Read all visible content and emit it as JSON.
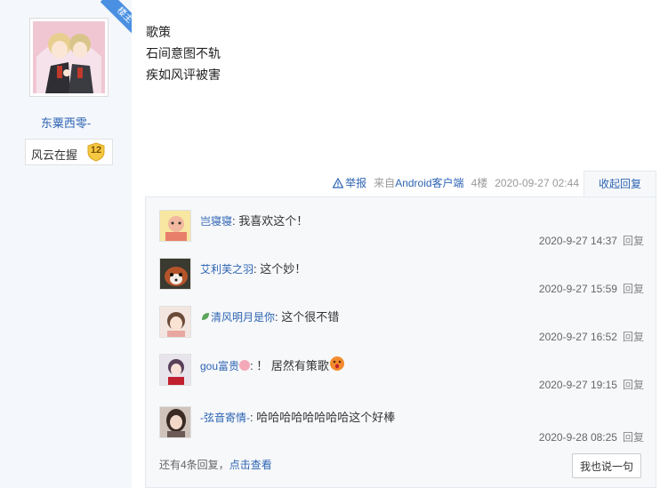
{
  "author": {
    "badge": "楼主",
    "name": "东粟西零-",
    "rank_name": "风云在握",
    "rank_level": "12"
  },
  "post": {
    "lines": [
      "歌策",
      "石间意图不轨",
      "疾如风评被害"
    ],
    "report_label": "举报",
    "source_prefix": "来自",
    "source_link": "Android客户端",
    "floor": "4楼",
    "timestamp": "2020-09-27 02:44",
    "collapse_label": "收起回复"
  },
  "replies": [
    {
      "name": "岂寝寝",
      "text": "我喜欢这个！",
      "time": "2020-9-27 14:37",
      "reply_label": "回复"
    },
    {
      "name": "艾利芙之羽",
      "text": "这个妙！",
      "time": "2020-9-27 15:59",
      "reply_label": "回复"
    },
    {
      "name": "清风明月是你",
      "text": "这个很不错",
      "time": "2020-9-27 16:52",
      "reply_label": "回复"
    },
    {
      "name": "gou富贵",
      "text": "！ 居然有策歌",
      "time": "2020-9-27 19:15",
      "reply_label": "回复"
    },
    {
      "name": "-弦音寄情-",
      "text": "哈哈哈哈哈哈哈哈这个好棒",
      "time": "2020-9-28 08:25",
      "reply_label": "回复"
    }
  ],
  "more": {
    "text": "还有4条回复，",
    "link": "点击查看"
  },
  "say_button": "我也说一句",
  "colors": {
    "link": "#2d64b3",
    "badge": "#4a90e2",
    "sidebar_bg": "#f4f7fb"
  }
}
